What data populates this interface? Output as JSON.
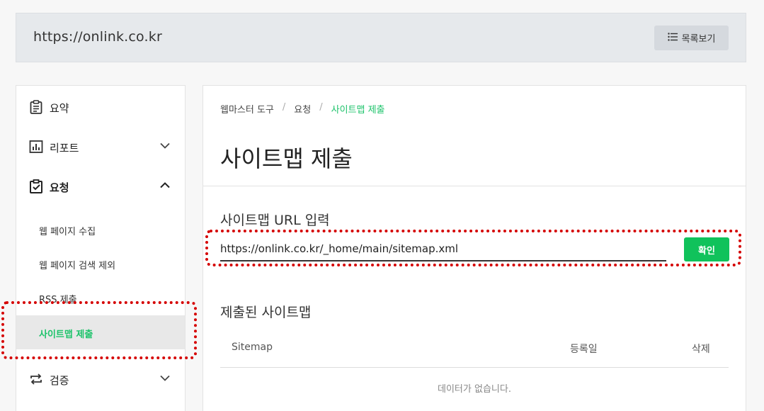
{
  "header": {
    "site_url": "https://onlink.co.kr",
    "list_button_label": "목록보기",
    "list_button_icon": "list-icon"
  },
  "sidebar": {
    "menu": [
      {
        "label": "요약",
        "icon": "clipboard-icon"
      },
      {
        "label": "리포트",
        "icon": "bar-chart-icon",
        "chevron": "down"
      },
      {
        "label": "요청",
        "icon": "checked-clipboard-icon",
        "chevron": "up"
      },
      {
        "label": "검증",
        "icon": "repeat-icon",
        "chevron": "down"
      }
    ],
    "submenu": [
      {
        "label": "웹 페이지 수집"
      },
      {
        "label": "웹 페이지 검색 제외"
      },
      {
        "label": "RSS 제출"
      },
      {
        "label": "사이트맵 제출",
        "active": true
      }
    ]
  },
  "main": {
    "breadcrumb": [
      "웹마스터 도구",
      "요청",
      "사이트맵 제출"
    ],
    "breadcrumb_separator": "/",
    "page_title": "사이트맵 제출",
    "url_section_title": "사이트맵 URL 입력",
    "url_input_value": "https://onlink.co.kr/_home/main/sitemap.xml",
    "confirm_label": "확인",
    "submitted_section_title": "제출된 사이트맵",
    "table_headers": [
      "Sitemap",
      "등록일",
      "삭제"
    ],
    "empty_message": "데이터가 없습니다."
  },
  "colors": {
    "accent_green": "#10c25b",
    "highlight_red": "#d50000"
  }
}
